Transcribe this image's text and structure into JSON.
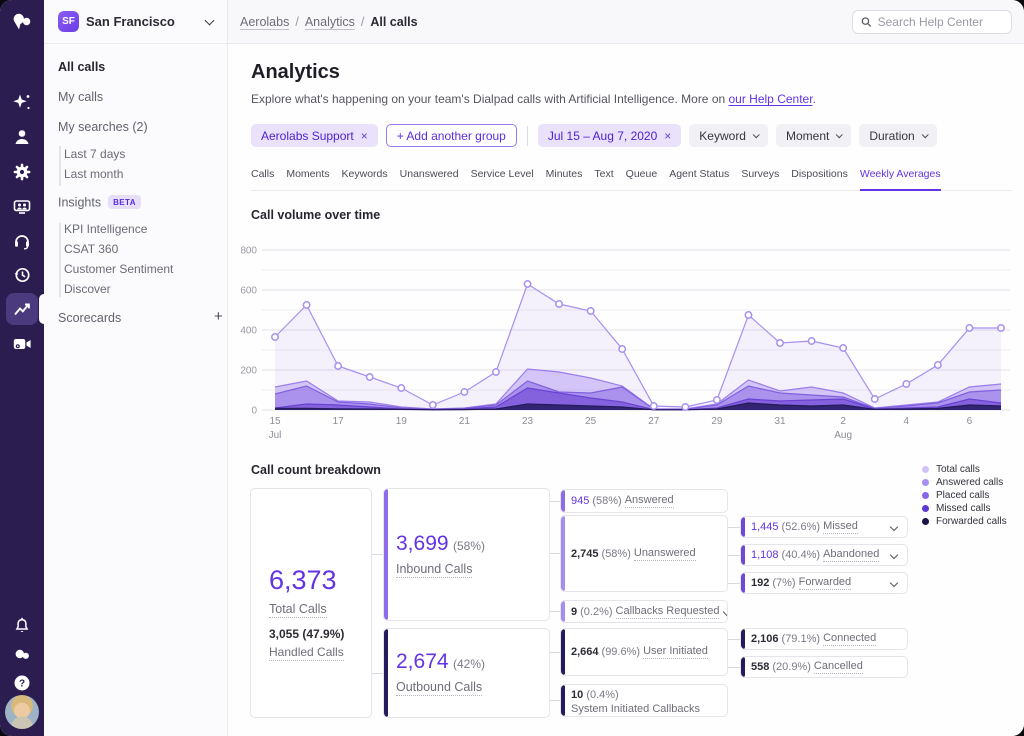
{
  "app": {
    "accent": "#6333e4"
  },
  "rail": {
    "icons": [
      "dialpad-logo",
      "ai-sparkles",
      "contacts",
      "settings",
      "meetings",
      "support-headset",
      "history",
      "analytics",
      "video-settings",
      "notifications",
      "messages",
      "help"
    ]
  },
  "sidebar": {
    "office_badge": "SF",
    "office_name": "San Francisco",
    "items": {
      "all_calls": "All calls",
      "my_calls": "My calls",
      "my_searches": "My searches (2)",
      "last_7_days": "Last 7 days",
      "last_month": "Last month",
      "insights": "Insights",
      "insights_badge": "BETA",
      "kpi": "KPI Intelligence",
      "csat": "CSAT 360",
      "sentiment": "Customer Sentiment",
      "discover": "Discover",
      "scorecards": "Scorecards",
      "scorecards_add": "+"
    }
  },
  "topbar": {
    "breadcrumb": [
      "Aerolabs",
      "Analytics",
      "All calls"
    ],
    "separator": "/",
    "search_placeholder": "Search Help Center"
  },
  "header": {
    "title": "Analytics",
    "subtitle_prefix": "Explore what's happening on your team's Dialpad calls with Artificial Intelligence. More on ",
    "subtitle_link": "our Help Center",
    "subtitle_suffix": "."
  },
  "filters": {
    "group_chip": "Aerolabs Support",
    "remove_x": "×",
    "add_group": "+ Add another group",
    "date_chip": "Jul 15 – Aug 7, 2020",
    "keyword": "Keyword",
    "moment": "Moment",
    "duration": "Duration"
  },
  "tabs": {
    "items": [
      "Calls",
      "Moments",
      "Keywords",
      "Unanswered",
      "Service Level",
      "Minutes",
      "Text",
      "Queue",
      "Agent Status",
      "Surveys",
      "Dispositions",
      "Weekly Averages"
    ],
    "active": "Weekly Averages"
  },
  "chart": {
    "title": "Call volume over time",
    "chart_data": {
      "type": "area",
      "x_days": [
        "15",
        "16",
        "17",
        "18",
        "19",
        "20",
        "21",
        "22",
        "23",
        "24",
        "25",
        "26",
        "27",
        "28",
        "29",
        "30",
        "31",
        "1",
        "2",
        "3",
        "4",
        "5",
        "6",
        "7"
      ],
      "x_tick_every": 2,
      "month_labels": [
        {
          "index": 0,
          "label": "Jul"
        },
        {
          "index": 18,
          "label": "Aug"
        }
      ],
      "ylim": [
        0,
        800
      ],
      "ytick_step": 200,
      "grid_step": 100,
      "series": [
        {
          "name": "Total calls",
          "color": "#a78fee",
          "fill": "rgba(124,82,232,0.08)",
          "markers": true,
          "values": [
            365,
            525,
            220,
            165,
            110,
            25,
            90,
            190,
            630,
            530,
            495,
            305,
            20,
            15,
            50,
            475,
            335,
            345,
            310,
            55,
            130,
            225,
            410,
            410
          ]
        },
        {
          "name": "Answered calls",
          "color": "#9b7eea",
          "fill": "rgba(135,100,235,0.30)",
          "values": [
            115,
            145,
            45,
            40,
            15,
            5,
            10,
            30,
            205,
            190,
            160,
            120,
            5,
            5,
            30,
            150,
            95,
            115,
            85,
            10,
            25,
            40,
            115,
            130
          ]
        },
        {
          "name": "Placed calls",
          "color": "#8160de",
          "fill": "rgba(120,84,225,0.45)",
          "values": [
            80,
            120,
            40,
            30,
            10,
            4,
            8,
            25,
            145,
            90,
            85,
            115,
            4,
            4,
            25,
            120,
            85,
            75,
            65,
            8,
            20,
            35,
            90,
            100
          ]
        },
        {
          "name": "Missed calls",
          "color": "#6a43d2",
          "fill": "rgba(106,67,210,0.60)",
          "values": [
            10,
            30,
            25,
            15,
            5,
            2,
            5,
            15,
            110,
            85,
            60,
            40,
            2,
            2,
            10,
            55,
            45,
            50,
            55,
            5,
            10,
            15,
            55,
            35
          ]
        },
        {
          "name": "Forwarded calls",
          "color": "#241a5e",
          "fill": "rgba(36,26,94,0.85)",
          "values": [
            8,
            8,
            6,
            5,
            3,
            1,
            2,
            5,
            30,
            25,
            20,
            15,
            1,
            1,
            5,
            35,
            25,
            20,
            25,
            3,
            5,
            8,
            25,
            20
          ]
        }
      ],
      "legend": [
        {
          "label": "Total calls",
          "color": "#cfc2f7"
        },
        {
          "label": "Answered calls",
          "color": "#a98ff1"
        },
        {
          "label": "Placed calls",
          "color": "#8a64e9"
        },
        {
          "label": "Missed calls",
          "color": "#5f3ad1"
        },
        {
          "label": "Forwarded calls",
          "color": "#1c1347"
        }
      ]
    }
  },
  "breakdown": {
    "title": "Call count breakdown",
    "total": {
      "value": "6,373",
      "label": "Total Calls",
      "sub_value": "3,055 (47.9%)",
      "sub_label": "Handled Calls"
    },
    "inbound": {
      "value": "3,699",
      "pct": "(58%)",
      "label": "Inbound Calls",
      "accent": "#8e6ce9"
    },
    "outbound": {
      "value": "2,674",
      "pct": "(42%)",
      "label": "Outbound Calls",
      "accent": "#241b5e"
    },
    "answered": {
      "value": "945",
      "pct": "(58%)",
      "label": "Answered",
      "accent": "#8e6ce9"
    },
    "unanswered": {
      "value": "2,745",
      "pct": "(58%)",
      "label": "Unanswered",
      "accent": "#a78df0"
    },
    "callbacks": {
      "value": "9",
      "pct": "(0.2%)",
      "label": "Callbacks Requested",
      "accent": "#a78df0"
    },
    "user_initiated": {
      "value": "2,664",
      "pct": "(99.6%)",
      "label": "User Initiated",
      "accent": "#241b5e"
    },
    "system_initiated": {
      "value": "10",
      "pct": "(0.4%)",
      "label": "System Initiated Callbacks",
      "accent": "#241b5e"
    },
    "missed": {
      "value": "1,445",
      "pct": "(52.6%)",
      "label": "Missed",
      "accent": "#6f48d6"
    },
    "abandoned": {
      "value": "1,108",
      "pct": "(40.4%)",
      "label": "Abandoned",
      "accent": "#6f48d6"
    },
    "forwarded": {
      "value": "192",
      "pct": "(7%)",
      "label": "Forwarded",
      "accent": "#6f48d6"
    },
    "connected": {
      "value": "2,106",
      "pct": "(79.1%)",
      "label": "Connected",
      "accent": "#241b5e"
    },
    "cancelled": {
      "value": "558",
      "pct": "(20.9%)",
      "label": "Cancelled",
      "accent": "#241b5e"
    }
  }
}
